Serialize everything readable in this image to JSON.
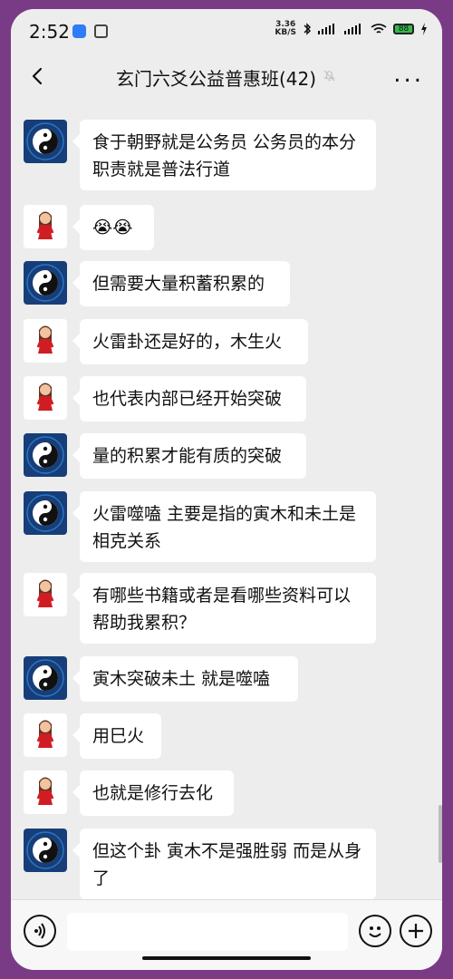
{
  "status": {
    "time": "2:52",
    "speed_top": "3.36",
    "speed_bottom": "KB/S",
    "battery": "88"
  },
  "header": {
    "title": "玄门六爻公益普惠班(42)"
  },
  "messages": [
    {
      "text": "食于朝野就是公务员  公务员的本分职责就是普法行道",
      "avatar": "taiji"
    },
    {
      "text": "😭😭",
      "avatar": "girl"
    },
    {
      "text": "但需要大量积蓄积累的",
      "avatar": "taiji"
    },
    {
      "text": "火雷卦还是好的，木生火",
      "avatar": "girl"
    },
    {
      "text": "也代表内部已经开始突破",
      "avatar": "girl"
    },
    {
      "text": "量的积累才能有质的突破",
      "avatar": "taiji"
    },
    {
      "text": "火雷噬嗑  主要是指的寅木和未土是相克关系",
      "avatar": "taiji"
    },
    {
      "text": "有哪些书籍或者是看哪些资料可以帮助我累积？",
      "avatar": "girl"
    },
    {
      "text": "寅木突破未土  就是噬嗑",
      "avatar": "taiji"
    },
    {
      "text": "用巳火",
      "avatar": "girl"
    },
    {
      "text": "也就是修行去化",
      "avatar": "girl"
    },
    {
      "text": "但这个卦 寅木不是强胜弱  而是从身了",
      "avatar": "taiji"
    }
  ]
}
